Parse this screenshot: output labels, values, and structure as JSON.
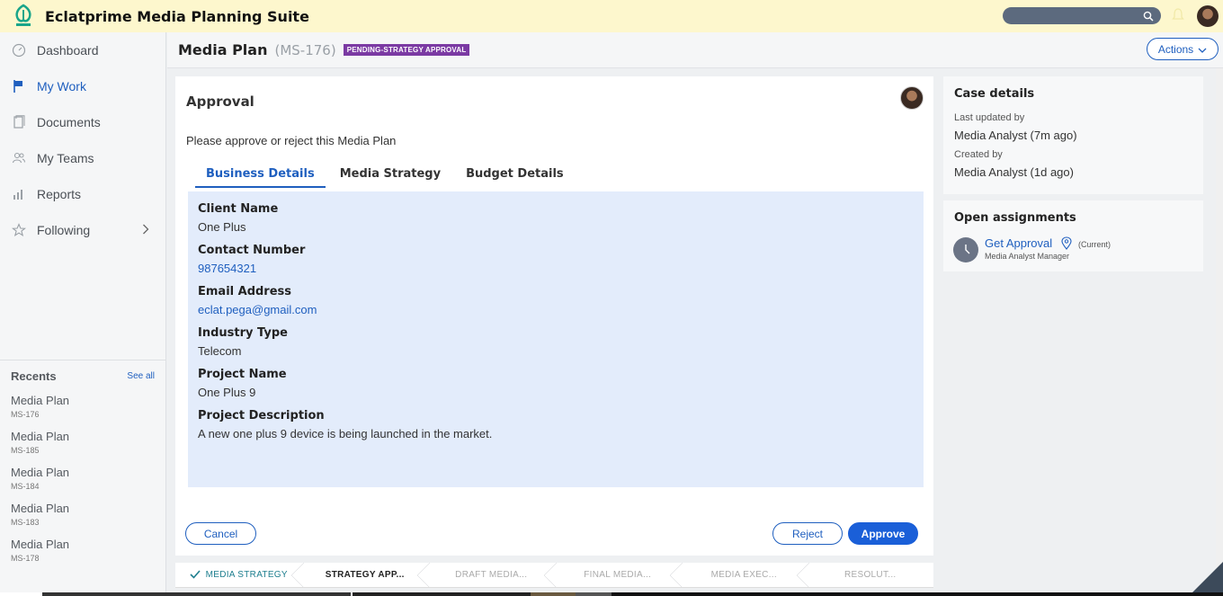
{
  "app": {
    "title": "Eclatprime Media Planning Suite"
  },
  "sidebar": {
    "items": [
      {
        "label": "Dashboard",
        "icon": "gauge-icon"
      },
      {
        "label": "My Work",
        "icon": "flag-icon"
      },
      {
        "label": "Documents",
        "icon": "document-icon"
      },
      {
        "label": "My Teams",
        "icon": "users-icon"
      },
      {
        "label": "Reports",
        "icon": "bar-chart-icon"
      },
      {
        "label": "Following",
        "icon": "star-icon"
      }
    ],
    "recents": {
      "title": "Recents",
      "see_all": "See all",
      "items": [
        {
          "label": "Media Plan",
          "id": "MS-176"
        },
        {
          "label": "Media Plan",
          "id": "MS-185"
        },
        {
          "label": "Media Plan",
          "id": "MS-184"
        },
        {
          "label": "Media Plan",
          "id": "MS-183"
        },
        {
          "label": "Media Plan",
          "id": "MS-178"
        }
      ]
    }
  },
  "header": {
    "case_title": "Media Plan",
    "case_id": "(MS-176)",
    "status": "PENDING-STRATEGY APPROVAL",
    "actions_label": "Actions"
  },
  "approval": {
    "title": "Approval",
    "instructions": "Please approve or reject this Media Plan",
    "tabs": [
      "Business Details",
      "Media Strategy",
      "Budget Details"
    ],
    "fields": [
      {
        "label": "Client Name",
        "value": "One Plus"
      },
      {
        "label": "Contact Number",
        "value": "987654321"
      },
      {
        "label": "Email Address",
        "value": "eclat.pega@gmail.com"
      },
      {
        "label": "Industry Type",
        "value": "Telecom"
      },
      {
        "label": "Project Name",
        "value": "One Plus 9"
      },
      {
        "label": "Project Description",
        "value": "A new one plus 9 device is being launched in the market."
      }
    ],
    "buttons": {
      "cancel": "Cancel",
      "reject": "Reject",
      "approve": "Approve"
    }
  },
  "stages": [
    "MEDIA STRATEGY",
    "STRATEGY APP...",
    "DRAFT MEDIA...",
    "FINAL MEDIA...",
    "MEDIA EXEC...",
    "RESOLUT..."
  ],
  "case_details": {
    "title": "Case details",
    "last_updated_label": "Last updated by",
    "last_updated_value": "Media Analyst (7m ago)",
    "created_label": "Created by",
    "created_value": "Media Analyst (1d ago)"
  },
  "open_assignments": {
    "title": "Open assignments",
    "name": "Get Approval",
    "current": "(Current)",
    "role": "Media Analyst Manager"
  },
  "colors": {
    "topbar": "#fdf7cd",
    "accent": "#1f5fbf",
    "status_badge": "#7b3aa3",
    "details_bg": "#e3ecfb"
  }
}
